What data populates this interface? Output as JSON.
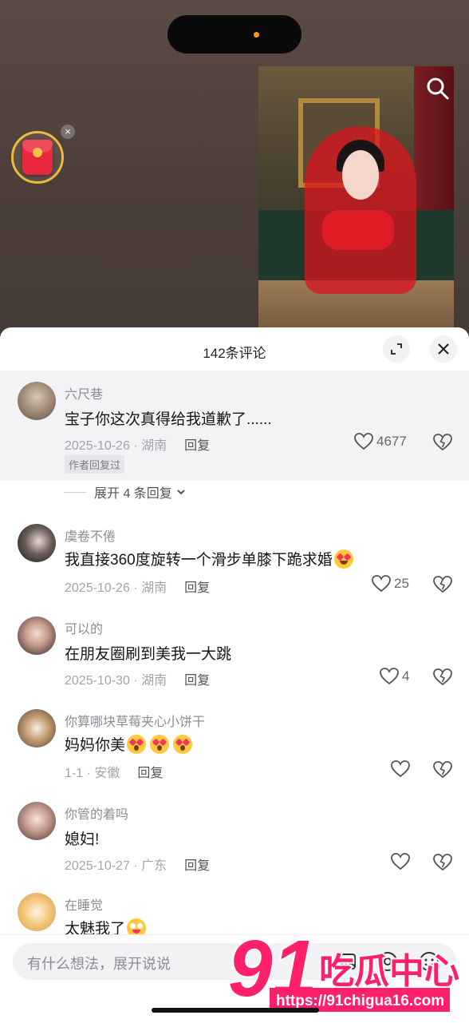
{
  "sheet": {
    "title": "142条评论"
  },
  "comments": [
    {
      "user": "六尺巷",
      "text": "宝子你这次真得给我道歉了......",
      "date": "2025-10-26 · 湖南",
      "reply": "回复",
      "likes": "4677",
      "author_tag": "作者回复过",
      "expand": "展开 4 条回复"
    },
    {
      "user": "虞卷不倦",
      "text": "我直接360度旋转一个滑步单膝下跪求婚",
      "date": "2025-10-26 · 湖南",
      "reply": "回复",
      "likes": "25"
    },
    {
      "user": "可以的",
      "text": "在朋友圈刷到美我一大跳",
      "date": "2025-10-30 · 湖南",
      "reply": "回复",
      "likes": "4"
    },
    {
      "user": "你算哪块草莓夹心小饼干",
      "text": "妈妈你美",
      "date": "1-1 · 安徽",
      "reply": "回复",
      "likes": ""
    },
    {
      "user": "你管的着吗",
      "text": "媳妇!",
      "date": "2025-10-27 · 广东",
      "reply": "回复",
      "likes": ""
    },
    {
      "user": "在睡觉",
      "text": "太魅我了",
      "date": "",
      "reply": "",
      "likes": ""
    }
  ],
  "input": {
    "placeholder": "有什么想法，展开说说"
  },
  "watermark": {
    "brand_number": "91",
    "brand_text": "吃瓜中心",
    "url": "https://91chigua16.com"
  },
  "colors": {
    "accent_red": "#e8283c",
    "watermark_pink": "#ff1f6b"
  }
}
